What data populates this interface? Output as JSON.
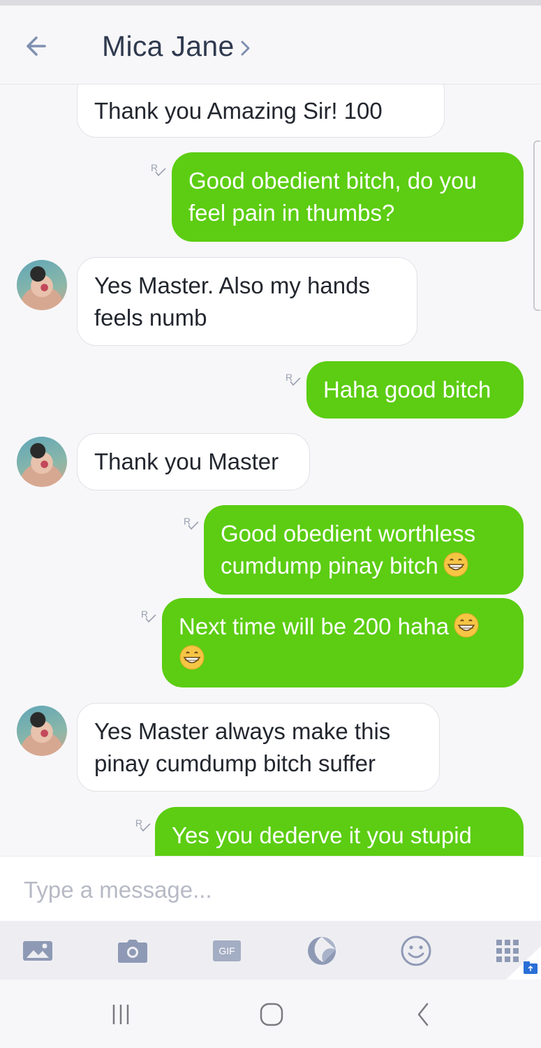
{
  "header": {
    "title": "Mica Jane"
  },
  "messages": [
    {
      "side": "in",
      "text": "Thank you Amazing Sir! 100",
      "truncated_above": "100"
    },
    {
      "side": "out",
      "line1": "Good obedient bitch, do you",
      "line2": "feel pain in thumbs?",
      "read_mark": "R"
    },
    {
      "side": "in",
      "line1": "Yes Master. Also my hands",
      "line2": "feels numb"
    },
    {
      "side": "out",
      "text": "Haha good bitch",
      "read_mark": "R"
    },
    {
      "side": "in",
      "text": "Thank you Master"
    },
    {
      "side": "out",
      "line1": "Good obedient worthless",
      "line2": "cumdump pinay bitch",
      "read_mark": "R"
    },
    {
      "side": "out",
      "line1": "Next time will be 200 haha",
      "read_mark": "R"
    },
    {
      "side": "in",
      "line1": "Yes Master always make this",
      "line2": "pinay cumdump bitch suffer"
    },
    {
      "side": "out",
      "text": "Yes you dederve it you stupid",
      "read_mark": "R"
    }
  ],
  "composer": {
    "placeholder": "Type a message..."
  },
  "toolbar": {
    "gif_label": "GIF"
  },
  "icons": {
    "back": "arrow-left-icon",
    "chevron": "chevron-right-icon",
    "gallery": "image-icon",
    "camera": "camera-icon",
    "gif": "gif-icon",
    "sticker": "sticker-icon",
    "emoji": "smiley-icon",
    "apps": "grid-icon"
  },
  "colors": {
    "outgoing": "#5ccd12",
    "incoming": "#ffffff",
    "accent": "#7f8fb0",
    "text": "#2f3a4f"
  }
}
